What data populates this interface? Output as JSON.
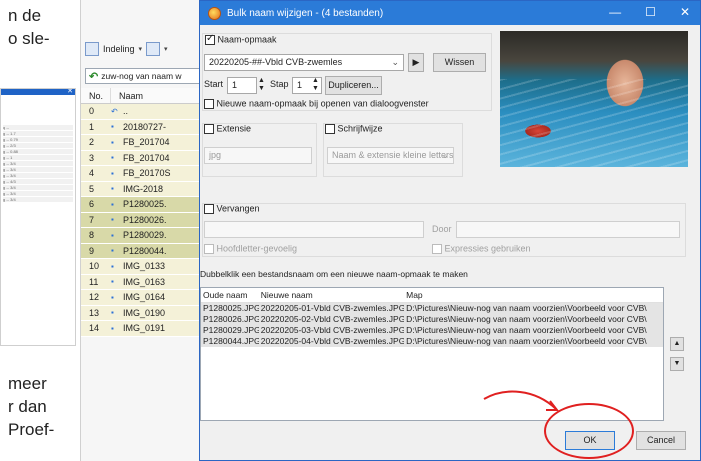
{
  "document": {
    "fragments": [
      "n  de",
      "o sle-",
      "meer",
      "r dan",
      "Proef-"
    ]
  },
  "left_thumbnail": {
    "rows": [
      "q --",
      "g -- 1.7",
      "g -- 0.79",
      "g -- 2/3",
      "g -- 0.88",
      "g -- 1",
      "g -- 3/4",
      "g -- 3/4",
      "g -- 3/4",
      "g -- 4/3",
      "g -- 3/4",
      "g -- 3/4",
      "g -- 3/4"
    ]
  },
  "file_manager": {
    "toolbar": {
      "layout_label": "Indeling",
      "layout_arrow": "▾",
      "view_arrow": "▾"
    },
    "path": "zuw-nog van naam w",
    "columns": {
      "no": "No.",
      "name": "Naam"
    },
    "rows": [
      {
        "no": "0",
        "name": "..",
        "selected": false,
        "icon": "up-icon"
      },
      {
        "no": "1",
        "name": "20180727-",
        "selected": false
      },
      {
        "no": "2",
        "name": "FB_201704",
        "selected": false
      },
      {
        "no": "3",
        "name": "FB_201704",
        "selected": false
      },
      {
        "no": "4",
        "name": "FB_20170S",
        "selected": false
      },
      {
        "no": "5",
        "name": "IMG-2018",
        "selected": false
      },
      {
        "no": "6",
        "name": "P1280025.",
        "selected": true
      },
      {
        "no": "7",
        "name": "P1280026.",
        "selected": true
      },
      {
        "no": "8",
        "name": "P1280029.",
        "selected": true
      },
      {
        "no": "9",
        "name": "P1280044.",
        "selected": true
      },
      {
        "no": "10",
        "name": "IMG_0133",
        "selected": false
      },
      {
        "no": "11",
        "name": "IMG_0163",
        "selected": false
      },
      {
        "no": "12",
        "name": "IMG_0164",
        "selected": false
      },
      {
        "no": "13",
        "name": "IMG_0190",
        "selected": false
      },
      {
        "no": "14",
        "name": "IMG_0191",
        "selected": false
      }
    ]
  },
  "dialog": {
    "title": "Bulk naam wijzigen - (4 bestanden)",
    "window_buttons": {
      "minimize": "—",
      "maximize": "☐",
      "close": "✕"
    },
    "name_format": {
      "label": "Naam-opmaak",
      "checked": true,
      "value": "20220205-##-Vbld CVB-zwemles",
      "play_glyph": "▶",
      "clear_label": "Wissen",
      "start_label": "Start",
      "start_value": "1",
      "step_label": "Stap",
      "step_value": "1",
      "duplicate_label": "Dupliceren...",
      "new_on_open_label": "Nieuwe naam-opmaak bij openen van dialoogvenster"
    },
    "extension": {
      "label": "Extensie",
      "value": "jpg"
    },
    "case": {
      "label": "Schrijfwijze",
      "value": "Naam & extensie kleine letters"
    },
    "replace": {
      "label": "Vervangen",
      "by_label": "Door",
      "case_sensitive_label": "Hoofdletter-gevoelig",
      "regex_label": "Expressies gebruiken"
    },
    "hint": "Dubbelklik een bestandsnaam om een nieuwe naam-opmaak te maken",
    "results": {
      "columns": {
        "old": "Oude naam",
        "new": "Nieuwe naam",
        "folder": "Map"
      },
      "rows": [
        {
          "old": "P1280025.JPG",
          "new": "20220205-01-Vbld CVB-zwemles.JPG",
          "folder": "D:\\Pictures\\Nieuw-nog van naam voorzien\\Voorbeeld voor CVB\\"
        },
        {
          "old": "P1280026.JPG",
          "new": "20220205-02-Vbld CVB-zwemles.JPG",
          "folder": "D:\\Pictures\\Nieuw-nog van naam voorzien\\Voorbeeld voor CVB\\"
        },
        {
          "old": "P1280029.JPG",
          "new": "20220205-03-Vbld CVB-zwemles.JPG",
          "folder": "D:\\Pictures\\Nieuw-nog van naam voorzien\\Voorbeeld voor CVB\\"
        },
        {
          "old": "P1280044.JPG",
          "new": "20220205-04-Vbld CVB-zwemles.JPG",
          "folder": "D:\\Pictures\\Nieuw-nog van naam voorzien\\Voorbeeld voor CVB\\"
        }
      ]
    },
    "move_up_glyph": "▲",
    "move_down_glyph": "▼",
    "ok_label": "OK",
    "cancel_label": "Cancel"
  },
  "colors": {
    "title_bar": "#2b7bd8",
    "highlight_annotation": "#e02020",
    "selected_row": "#d8d9a8"
  }
}
